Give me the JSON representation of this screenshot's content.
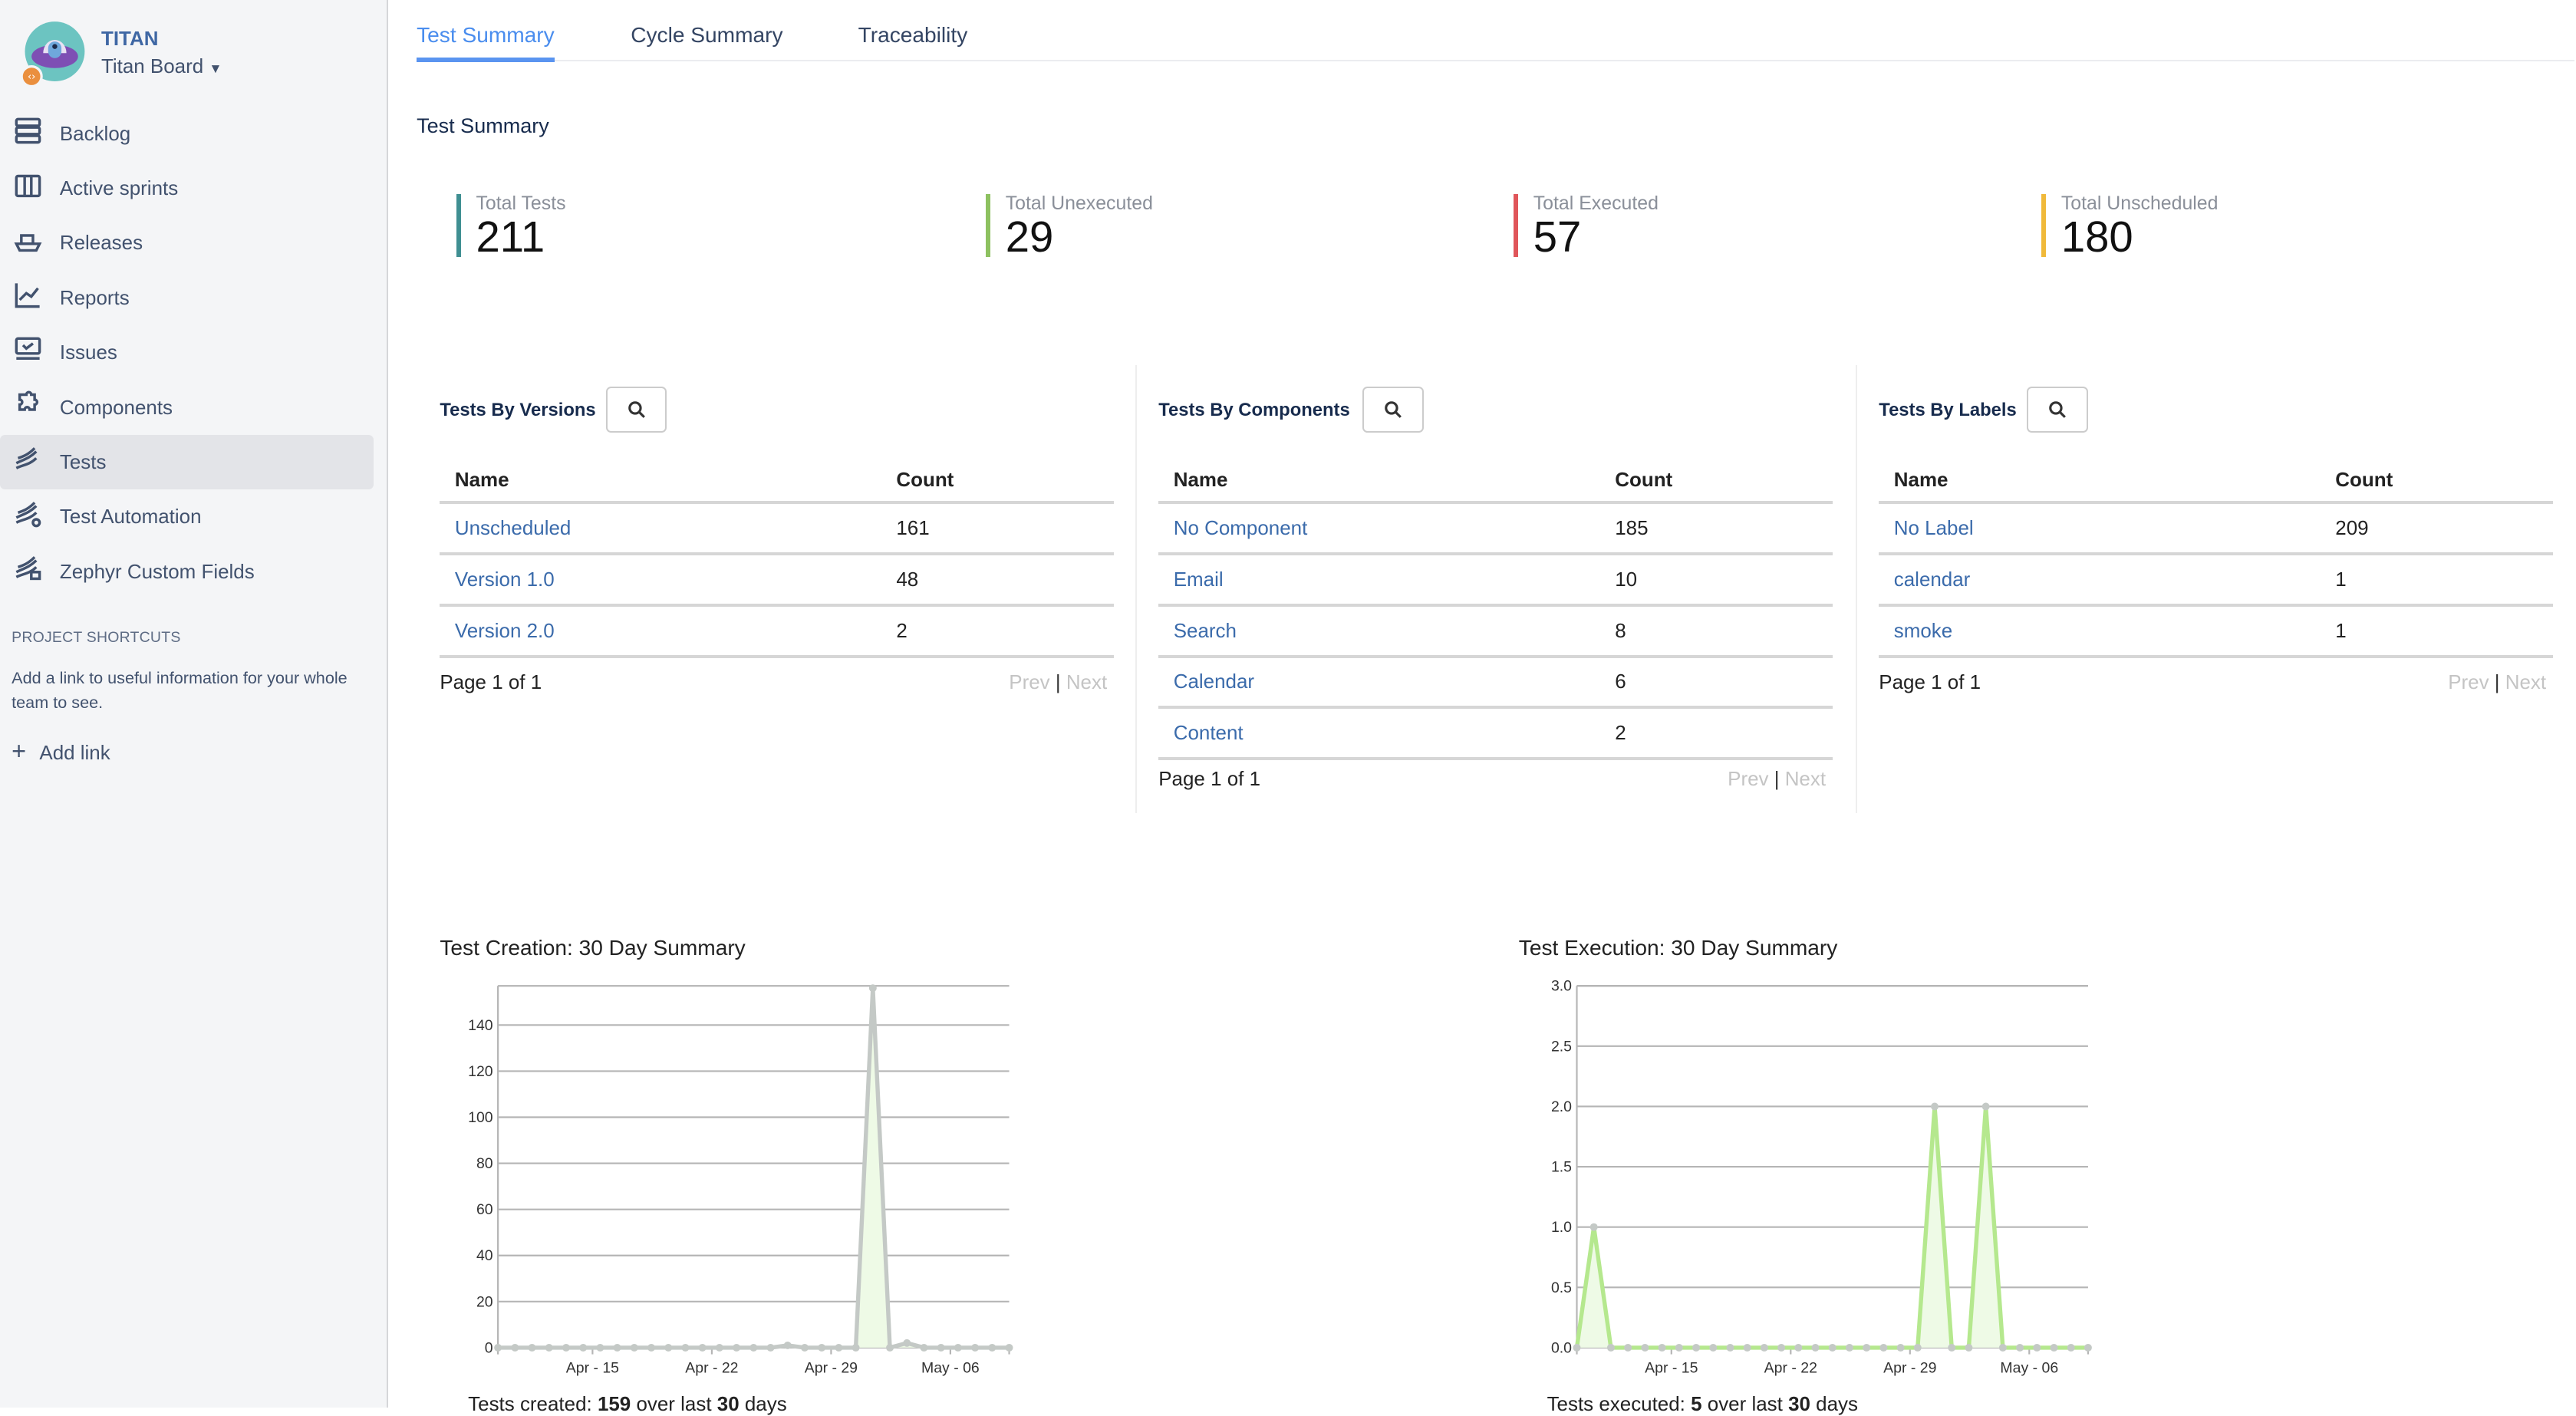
{
  "sidebar": {
    "project_name": "TITAN",
    "board_name": "Titan Board",
    "items": [
      {
        "label": "Backlog",
        "icon": "backlog-icon",
        "active": false
      },
      {
        "label": "Active sprints",
        "icon": "board-columns-icon",
        "active": false
      },
      {
        "label": "Releases",
        "icon": "ship-icon",
        "active": false
      },
      {
        "label": "Reports",
        "icon": "line-chart-icon",
        "active": false
      },
      {
        "label": "Issues",
        "icon": "issues-icon",
        "active": false
      },
      {
        "label": "Components",
        "icon": "puzzle-icon",
        "active": false
      },
      {
        "label": "Tests",
        "icon": "zephyr-icon",
        "active": true
      },
      {
        "label": "Test Automation",
        "icon": "zephyr-automation-icon",
        "active": false
      },
      {
        "label": "Zephyr Custom Fields",
        "icon": "zephyr-fields-icon",
        "active": false
      }
    ],
    "shortcuts_heading": "PROJECT SHORTCUTS",
    "shortcuts_desc": "Add a link to useful information for your whole team to see.",
    "add_link": "Add link"
  },
  "tabs": [
    {
      "label": "Test Summary",
      "active": true
    },
    {
      "label": "Cycle Summary",
      "active": false
    },
    {
      "label": "Traceability",
      "active": false
    }
  ],
  "section_title": "Test Summary",
  "stats": [
    {
      "label": "Total Tests",
      "value": "211",
      "color": "#3f8f92"
    },
    {
      "label": "Total Unexecuted",
      "value": "29",
      "color": "#8dc160"
    },
    {
      "label": "Total Executed",
      "value": "57",
      "color": "#e0565a"
    },
    {
      "label": "Total Unscheduled",
      "value": "180",
      "color": "#f0b93a"
    }
  ],
  "panels": [
    {
      "title": "Tests By Versions",
      "columns": [
        "Name",
        "Count"
      ],
      "rows": [
        [
          "Unscheduled",
          "161"
        ],
        [
          "Version 1.0",
          "48"
        ],
        [
          "Version 2.0",
          "2"
        ]
      ],
      "page": "Page 1 of 1",
      "prev": "Prev",
      "next": "Next"
    },
    {
      "title": "Tests By Components",
      "columns": [
        "Name",
        "Count"
      ],
      "rows": [
        [
          "No Component",
          "185"
        ],
        [
          "Email",
          "10"
        ],
        [
          "Search",
          "8"
        ],
        [
          "Calendar",
          "6"
        ],
        [
          "Content",
          "2"
        ]
      ],
      "page": "Page 1 of 1",
      "prev": "Prev",
      "next": "Next"
    },
    {
      "title": "Tests By Labels",
      "columns": [
        "Name",
        "Count"
      ],
      "rows": [
        [
          "No Label",
          "209"
        ],
        [
          "calendar",
          "1"
        ],
        [
          "smoke",
          "1"
        ]
      ],
      "page": "Page 1 of 1",
      "prev": "Prev",
      "next": "Next"
    }
  ],
  "chart_data": [
    {
      "type": "area",
      "title": "Test Creation: 30 Day Summary",
      "x": [
        "Apr 09",
        "Apr 10",
        "Apr 11",
        "Apr 12",
        "Apr 13",
        "Apr 14",
        "Apr 15",
        "Apr 16",
        "Apr 17",
        "Apr 18",
        "Apr 19",
        "Apr 20",
        "Apr 21",
        "Apr 22",
        "Apr 23",
        "Apr 24",
        "Apr 25",
        "Apr 26",
        "Apr 27",
        "Apr 28",
        "Apr 29",
        "Apr 30",
        "May 01",
        "May 02",
        "May 03",
        "May 04",
        "May 05",
        "May 06",
        "May 07",
        "May 08",
        "May 09"
      ],
      "values": [
        0,
        0,
        0,
        0,
        0,
        0,
        0,
        0,
        0,
        0,
        0,
        0,
        0,
        0,
        0,
        0,
        0,
        1,
        0,
        0,
        0,
        0,
        156,
        0,
        2,
        0,
        0,
        0,
        0,
        0,
        0
      ],
      "xticks": [
        "Apr - 15",
        "Apr - 22",
        "Apr - 29",
        "May - 06"
      ],
      "yticks": [
        "0",
        "20",
        "40",
        "60",
        "80",
        "100",
        "120",
        "140"
      ],
      "ylim": [
        0,
        157
      ],
      "line_color": "#c4c9c6",
      "fill_color": "#eefae6",
      "grid": true,
      "footer": {
        "prefix": "Tests created: ",
        "count": "159",
        "middle": " over last ",
        "days": "30",
        "suffix": " days"
      }
    },
    {
      "type": "area",
      "title": "Test Execution: 30 Day Summary",
      "x": [
        "Apr 09",
        "Apr 10",
        "Apr 11",
        "Apr 12",
        "Apr 13",
        "Apr 14",
        "Apr 15",
        "Apr 16",
        "Apr 17",
        "Apr 18",
        "Apr 19",
        "Apr 20",
        "Apr 21",
        "Apr 22",
        "Apr 23",
        "Apr 24",
        "Apr 25",
        "Apr 26",
        "Apr 27",
        "Apr 28",
        "Apr 29",
        "Apr 30",
        "May 01",
        "May 02",
        "May 03",
        "May 04",
        "May 05",
        "May 06",
        "May 07",
        "May 08",
        "May 09"
      ],
      "values": [
        0,
        1,
        0,
        0,
        0,
        0,
        0,
        0,
        0,
        0,
        0,
        0,
        0,
        0,
        0,
        0,
        0,
        0,
        0,
        0,
        0,
        2,
        0,
        0,
        2,
        0,
        0,
        0,
        0,
        0,
        0
      ],
      "xticks": [
        "Apr - 15",
        "Apr - 22",
        "Apr - 29",
        "May - 06"
      ],
      "yticks": [
        "0.0",
        "0.5",
        "1.0",
        "1.5",
        "2.0",
        "2.5",
        "3.0"
      ],
      "ylim": [
        0,
        3
      ],
      "line_color": "#b5e88e",
      "fill_color": "#eefae6",
      "grid": true,
      "footer": {
        "prefix": "Tests executed: ",
        "count": "5",
        "middle": " over last ",
        "days": "30",
        "suffix": " days"
      }
    }
  ]
}
